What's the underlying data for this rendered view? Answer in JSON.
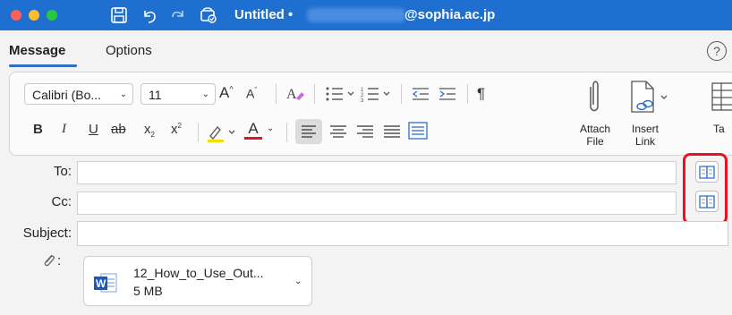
{
  "window": {
    "title_prefix": "Untitled •",
    "title_suffix": "@sophia.ac.jp"
  },
  "tabs": [
    {
      "label": "Message",
      "active": true
    },
    {
      "label": "Options",
      "active": false
    }
  ],
  "help": {
    "glyph": "?"
  },
  "ribbon": {
    "font_name": "Calibri (Bo...",
    "font_size": "11",
    "attach_file_label": [
      "Attach",
      "File"
    ],
    "insert_link_label": [
      "Insert",
      "Link"
    ],
    "table_label_partial": "Ta",
    "bold": "B",
    "italic": "I",
    "underline": "U",
    "strike": "ab",
    "subscript": "x",
    "superscript": "x",
    "grow_font": "A",
    "shrink_font": "A",
    "font_color": "A",
    "paragraph_mark": "¶"
  },
  "fields": {
    "to_label": "To:",
    "cc_label": "Cc:",
    "subject_label": "Subject:",
    "attachment_label": ":"
  },
  "attachment": {
    "file_name": "12_How_to_Use_Out...",
    "file_size": "5 MB",
    "icon_text": "W"
  },
  "colors": {
    "titlebar": "#1e6fd0",
    "accent": "#2d6fc9",
    "highlight_box": "#e3141f",
    "word_blue": "#185abd"
  }
}
